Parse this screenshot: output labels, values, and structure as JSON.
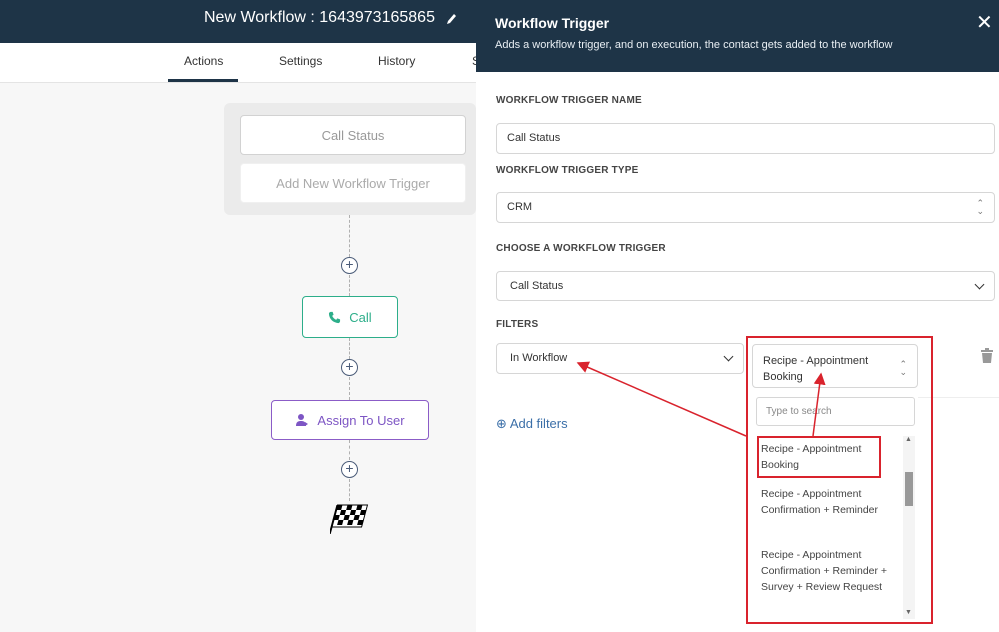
{
  "header": {
    "workflow_title": "New Workflow : 1643973165865"
  },
  "tabs": {
    "actions": "Actions",
    "settings": "Settings",
    "history": "History",
    "partial": "S"
  },
  "canvas": {
    "trigger_card_1": "Call Status",
    "trigger_card_2": "Add New Workflow Trigger",
    "call_label": "Call",
    "assign_label": "Assign To User"
  },
  "panel": {
    "title": "Workflow Trigger",
    "subtitle": "Adds a workflow trigger, and on execution, the contact gets added to the workflow",
    "name_label": "WORKFLOW TRIGGER NAME",
    "name_value": "Call Status",
    "type_label": "WORKFLOW TRIGGER TYPE",
    "type_value": "CRM",
    "choose_label": "CHOOSE A WORKFLOW TRIGGER",
    "choose_value": "Call Status",
    "filters_label": "FILTERS",
    "filter_field": "In Workflow",
    "filter_value": "Recipe - Appointment Booking",
    "add_filters": "Add filters",
    "search_placeholder": "Type to search",
    "options": [
      "Recipe - Appointment Booking",
      "Recipe - Appointment Confirmation + Reminder",
      "Recipe - Appointment Confirmation + Reminder + Survey + Review Request"
    ]
  },
  "colors": {
    "header_bg": "#1e3447",
    "call_green": "#2dae8a",
    "assign_purple": "#7d55c4",
    "annotation_red": "#d9232d",
    "link_blue": "#3b6fa8"
  }
}
